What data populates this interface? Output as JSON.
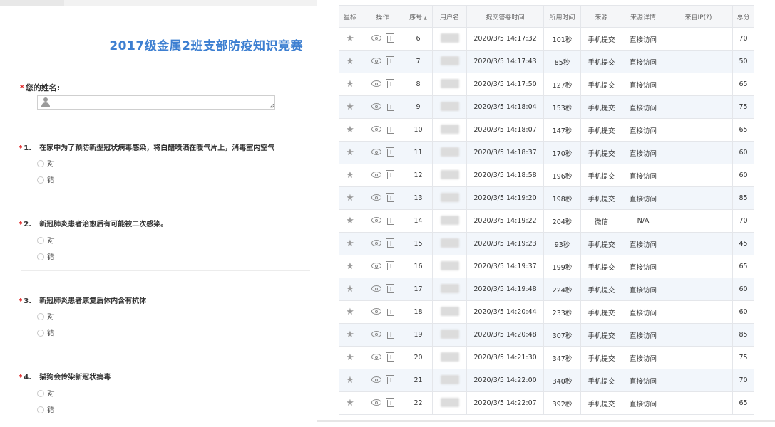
{
  "form": {
    "title": "2017级金属2班支部防疫知识竞赛",
    "name_label": "您的姓名:",
    "required_mark": "*",
    "questions": [
      {
        "num": "1.",
        "text": "在家中为了预防新型冠状病毒感染，将白醋喷洒在暖气片上，消毒室内空气",
        "options": [
          "对",
          "错"
        ]
      },
      {
        "num": "2.",
        "text": "新冠肺炎患者治愈后有可能被二次感染。",
        "options": [
          "对",
          "错"
        ]
      },
      {
        "num": "3.",
        "text": "新冠肺炎患者康复后体内含有抗体",
        "options": [
          "对",
          "错"
        ]
      },
      {
        "num": "4.",
        "text": "猫狗会传染新冠状病毒",
        "options": [
          "对",
          "错"
        ]
      }
    ]
  },
  "table": {
    "headers": [
      "星标",
      "操作",
      "序号",
      "用户名",
      "提交答卷时间",
      "所用时间",
      "来源",
      "来源详情",
      "来自IP(?)",
      "总分"
    ],
    "rows": [
      {
        "seq": "6",
        "time": "2020/3/5 14:17:32",
        "duration": "101秒",
        "source": "手机提交",
        "detail": "直接访问",
        "ip": "",
        "score": "70"
      },
      {
        "seq": "7",
        "time": "2020/3/5 14:17:43",
        "duration": "85秒",
        "source": "手机提交",
        "detail": "直接访问",
        "ip": "",
        "score": "50"
      },
      {
        "seq": "8",
        "time": "2020/3/5 14:17:50",
        "duration": "127秒",
        "source": "手机提交",
        "detail": "直接访问",
        "ip": "",
        "score": "65"
      },
      {
        "seq": "9",
        "time": "2020/3/5 14:18:04",
        "duration": "153秒",
        "source": "手机提交",
        "detail": "直接访问",
        "ip": "",
        "score": "75"
      },
      {
        "seq": "10",
        "time": "2020/3/5 14:18:07",
        "duration": "147秒",
        "source": "手机提交",
        "detail": "直接访问",
        "ip": "",
        "score": "65"
      },
      {
        "seq": "11",
        "time": "2020/3/5 14:18:37",
        "duration": "170秒",
        "source": "手机提交",
        "detail": "直接访问",
        "ip": "",
        "score": "60"
      },
      {
        "seq": "12",
        "time": "2020/3/5 14:18:58",
        "duration": "196秒",
        "source": "手机提交",
        "detail": "直接访问",
        "ip": "",
        "score": "60"
      },
      {
        "seq": "13",
        "time": "2020/3/5 14:19:20",
        "duration": "198秒",
        "source": "手机提交",
        "detail": "直接访问",
        "ip": "",
        "score": "85"
      },
      {
        "seq": "14",
        "time": "2020/3/5 14:19:22",
        "duration": "204秒",
        "source": "微信",
        "detail": "N/A",
        "ip": "",
        "score": "70"
      },
      {
        "seq": "15",
        "time": "2020/3/5 14:19:23",
        "duration": "93秒",
        "source": "手机提交",
        "detail": "直接访问",
        "ip": "",
        "score": "45"
      },
      {
        "seq": "16",
        "time": "2020/3/5 14:19:37",
        "duration": "199秒",
        "source": "手机提交",
        "detail": "直接访问",
        "ip": "",
        "score": "65"
      },
      {
        "seq": "17",
        "time": "2020/3/5 14:19:48",
        "duration": "224秒",
        "source": "手机提交",
        "detail": "直接访问",
        "ip": "",
        "score": "60"
      },
      {
        "seq": "18",
        "time": "2020/3/5 14:20:44",
        "duration": "233秒",
        "source": "手机提交",
        "detail": "直接访问",
        "ip": "",
        "score": "60"
      },
      {
        "seq": "19",
        "time": "2020/3/5 14:20:48",
        "duration": "307秒",
        "source": "手机提交",
        "detail": "直接访问",
        "ip": "",
        "score": "85"
      },
      {
        "seq": "20",
        "time": "2020/3/5 14:21:30",
        "duration": "347秒",
        "source": "手机提交",
        "detail": "直接访问",
        "ip": "",
        "score": "75"
      },
      {
        "seq": "21",
        "time": "2020/3/5 14:22:00",
        "duration": "340秒",
        "source": "手机提交",
        "detail": "直接访问",
        "ip": "",
        "score": "70"
      },
      {
        "seq": "22",
        "time": "2020/3/5 14:22:07",
        "duration": "392秒",
        "source": "手机提交",
        "detail": "直接访问",
        "ip": "",
        "score": "65"
      }
    ]
  },
  "icons": {
    "star": "star-icon",
    "view": "eye-icon",
    "delete": "trash-icon",
    "user": "user-icon"
  }
}
